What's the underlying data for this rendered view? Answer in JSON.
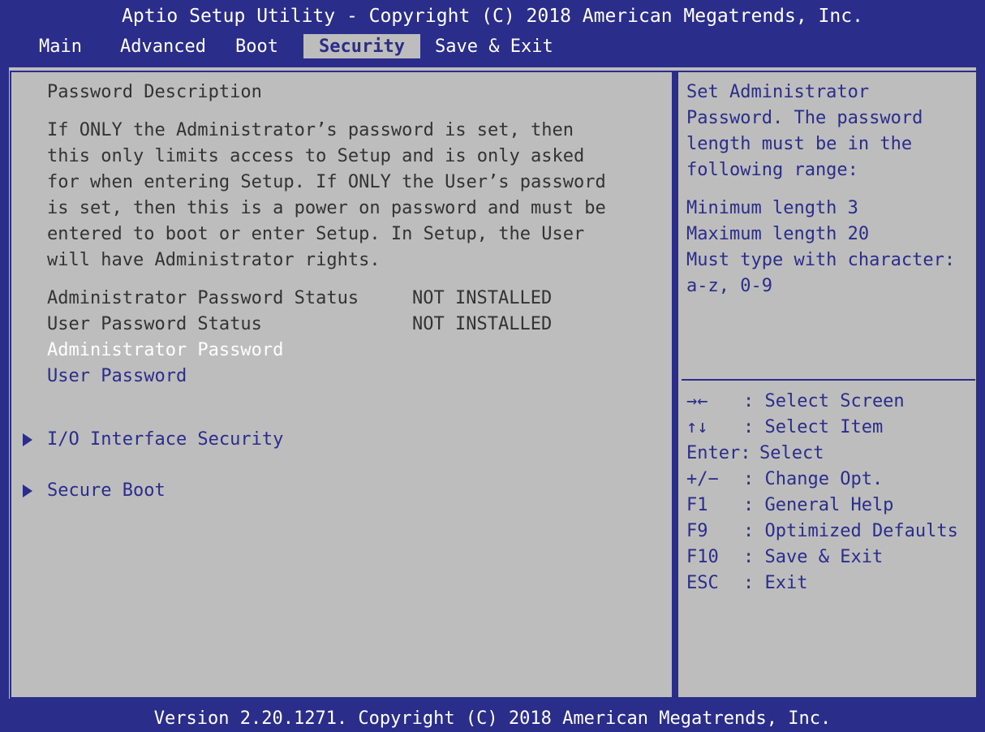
{
  "header": {
    "title": "Aptio Setup Utility - Copyright (C) 2018 American Megatrends, Inc."
  },
  "tabs": [
    {
      "label": "Main"
    },
    {
      "label": "Advanced"
    },
    {
      "label": "Boot"
    },
    {
      "label": "Security",
      "active": true
    },
    {
      "label": "Save & Exit"
    }
  ],
  "main": {
    "section_title": "Password Description",
    "description_lines": [
      "If ONLY the Administrator’s password is set, then",
      "this only limits access to Setup and is only asked",
      "for when entering Setup. If ONLY the User’s password",
      "is set, then this is a power on password and must be",
      "entered to boot or enter Setup. In Setup, the User",
      "will have Administrator rights."
    ],
    "status_rows": [
      {
        "label": "Administrator Password Status",
        "value": "NOT INSTALLED"
      },
      {
        "label": "User Password Status",
        "value": "NOT INSTALLED"
      }
    ],
    "admin_password_label": "Administrator Password",
    "user_password_label": "User Password",
    "submenus": [
      {
        "label": "I/O Interface Security"
      },
      {
        "label": "Secure Boot"
      }
    ]
  },
  "help": {
    "lines": [
      "Set Administrator",
      "Password. The password",
      "length must be in the",
      "following range:"
    ],
    "range_lines": [
      "Minimum length 3",
      "Maximum length 20",
      "Must type with character:",
      "a-z, 0-9"
    ]
  },
  "keys": [
    {
      "key": "→←",
      "action": ": Select Screen"
    },
    {
      "key": "↑↓",
      "action": ": Select Item"
    },
    {
      "key": "Enter:",
      "action": "Select"
    },
    {
      "key": "+/−",
      "action": ": Change Opt."
    },
    {
      "key": "F1",
      "action": ": General Help"
    },
    {
      "key": "F9",
      "action": ": Optimized Defaults"
    },
    {
      "key": "F10",
      "action": ": Save & Exit"
    },
    {
      "key": "ESC",
      "action": ": Exit"
    }
  ],
  "footer": {
    "text": "Version 2.20.1271. Copyright (C) 2018 American Megatrends, Inc."
  },
  "colors": {
    "background": "#2a2d8a",
    "panel": "#bdbdbd",
    "highlight": "#ffffff",
    "text": "#333333"
  }
}
